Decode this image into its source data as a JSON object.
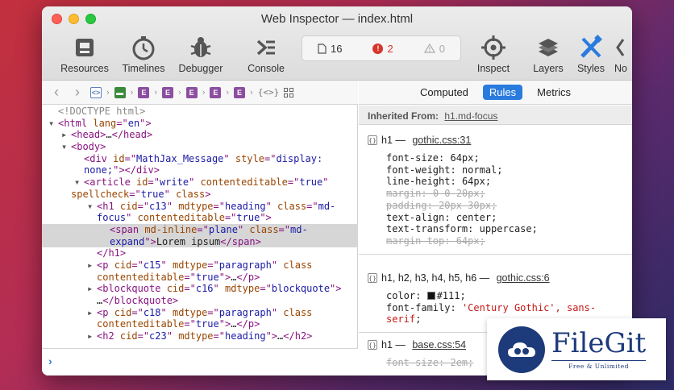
{
  "window": {
    "title": "Web Inspector — index.html"
  },
  "toolbar": {
    "tools": [
      {
        "label": "Resources",
        "icon": "resources-icon"
      },
      {
        "label": "Timelines",
        "icon": "timelines-icon"
      },
      {
        "label": "Debugger",
        "icon": "debugger-icon"
      },
      {
        "label": "Console",
        "icon": "console-icon"
      },
      {
        "label": "Inspect",
        "icon": "inspect-icon"
      },
      {
        "label": "Layers",
        "icon": "layers-icon"
      },
      {
        "label": "Styles",
        "icon": "styles-icon"
      },
      {
        "label": "No",
        "icon": "chevron-left-icon"
      }
    ],
    "status": {
      "resources_count": "16",
      "errors_count": "2",
      "warnings_count": "0"
    }
  },
  "breadcrumb": {
    "items": [
      "doc",
      "html",
      "E",
      "E",
      "E",
      "E",
      "E"
    ]
  },
  "dom_tree": {
    "doctype": "<!DOCTYPE html>",
    "lines": [
      {
        "indent": 0,
        "arrow": "▾",
        "parts": [
          [
            "tag",
            "<html "
          ],
          [
            "attr",
            "lang"
          ],
          [
            "tag",
            "=\""
          ],
          [
            "val",
            "en"
          ],
          [
            "tag",
            "\">"
          ]
        ]
      },
      {
        "indent": 1,
        "arrow": "▸",
        "parts": [
          [
            "tag",
            "<head>"
          ],
          [
            "txt",
            "…"
          ],
          [
            "tag",
            "</head>"
          ]
        ]
      },
      {
        "indent": 1,
        "arrow": "▾",
        "parts": [
          [
            "tag",
            "<body>"
          ]
        ]
      },
      {
        "indent": 2,
        "arrow": "",
        "parts": [
          [
            "tag",
            "<div "
          ],
          [
            "attr",
            "id"
          ],
          [
            "tag",
            "=\""
          ],
          [
            "val",
            "MathJax_Message"
          ],
          [
            "tag",
            "\" "
          ],
          [
            "attr",
            "style"
          ],
          [
            "tag",
            "=\""
          ],
          [
            "val",
            "display:"
          ]
        ]
      },
      {
        "indent": 2,
        "arrow": "",
        "parts": [
          [
            "val",
            "none;"
          ],
          [
            "tag",
            "\"></div>"
          ]
        ]
      },
      {
        "indent": 2,
        "arrow": "▾",
        "parts": [
          [
            "tag",
            "<article "
          ],
          [
            "attr",
            "id"
          ],
          [
            "tag",
            "=\""
          ],
          [
            "val",
            "write"
          ],
          [
            "tag",
            "\" "
          ],
          [
            "attr",
            "contenteditable"
          ],
          [
            "tag",
            "=\""
          ],
          [
            "val",
            "true"
          ],
          [
            "tag",
            "\""
          ]
        ]
      },
      {
        "indent": 1,
        "arrow": "",
        "parts": [
          [
            "attr",
            "spellcheck"
          ],
          [
            "tag",
            "=\""
          ],
          [
            "val",
            "true"
          ],
          [
            "tag",
            "\" "
          ],
          [
            "attr",
            "class"
          ],
          [
            "tag",
            ">"
          ]
        ]
      },
      {
        "indent": 3,
        "arrow": "▾",
        "parts": [
          [
            "tag",
            "<h1 "
          ],
          [
            "attr",
            "cid"
          ],
          [
            "tag",
            "=\""
          ],
          [
            "val",
            "c13"
          ],
          [
            "tag",
            "\" "
          ],
          [
            "attr",
            "mdtype"
          ],
          [
            "tag",
            "=\""
          ],
          [
            "val",
            "heading"
          ],
          [
            "tag",
            "\" "
          ],
          [
            "attr",
            "class"
          ],
          [
            "tag",
            "=\""
          ],
          [
            "val",
            "md-"
          ]
        ]
      },
      {
        "indent": 3,
        "arrow": "",
        "parts": [
          [
            "val",
            "focus"
          ],
          [
            "tag",
            "\" "
          ],
          [
            "attr",
            "contenteditable"
          ],
          [
            "tag",
            "=\""
          ],
          [
            "val",
            "true"
          ],
          [
            "tag",
            "\">"
          ]
        ]
      },
      {
        "indent": 4,
        "arrow": "",
        "sel": true,
        "parts": [
          [
            "tag",
            "<span "
          ],
          [
            "attr",
            "md-inline"
          ],
          [
            "tag",
            "=\""
          ],
          [
            "val",
            "plane"
          ],
          [
            "tag",
            "\" "
          ],
          [
            "attr",
            "class"
          ],
          [
            "tag",
            "=\""
          ],
          [
            "val",
            "md-"
          ]
        ]
      },
      {
        "indent": 4,
        "arrow": "",
        "sel": true,
        "parts": [
          [
            "val",
            "expand"
          ],
          [
            "tag",
            "\">"
          ],
          [
            "txt",
            "Lorem ipsum"
          ],
          [
            "tag",
            "</span>"
          ]
        ]
      },
      {
        "indent": 3,
        "arrow": "",
        "parts": [
          [
            "tag",
            "</h1>"
          ]
        ]
      },
      {
        "indent": 3,
        "arrow": "▸",
        "parts": [
          [
            "tag",
            "<p "
          ],
          [
            "attr",
            "cid"
          ],
          [
            "tag",
            "=\""
          ],
          [
            "val",
            "c15"
          ],
          [
            "tag",
            "\" "
          ],
          [
            "attr",
            "mdtype"
          ],
          [
            "tag",
            "=\""
          ],
          [
            "val",
            "paragraph"
          ],
          [
            "tag",
            "\" "
          ],
          [
            "attr",
            "class"
          ]
        ]
      },
      {
        "indent": 3,
        "arrow": "",
        "parts": [
          [
            "attr",
            "contenteditable"
          ],
          [
            "tag",
            "=\""
          ],
          [
            "val",
            "true"
          ],
          [
            "tag",
            "\">"
          ],
          [
            "txt",
            "…"
          ],
          [
            "tag",
            "</p>"
          ]
        ]
      },
      {
        "indent": 3,
        "arrow": "▸",
        "parts": [
          [
            "tag",
            "<blockquote "
          ],
          [
            "attr",
            "cid"
          ],
          [
            "tag",
            "=\""
          ],
          [
            "val",
            "c16"
          ],
          [
            "tag",
            "\" "
          ],
          [
            "attr",
            "mdtype"
          ],
          [
            "tag",
            "=\""
          ],
          [
            "val",
            "blockquote"
          ],
          [
            "tag",
            "\">"
          ]
        ]
      },
      {
        "indent": 3,
        "arrow": "",
        "parts": [
          [
            "txt",
            "…"
          ],
          [
            "tag",
            "</blockquote>"
          ]
        ]
      },
      {
        "indent": 3,
        "arrow": "▸",
        "parts": [
          [
            "tag",
            "<p "
          ],
          [
            "attr",
            "cid"
          ],
          [
            "tag",
            "=\""
          ],
          [
            "val",
            "c18"
          ],
          [
            "tag",
            "\" "
          ],
          [
            "attr",
            "mdtype"
          ],
          [
            "tag",
            "=\""
          ],
          [
            "val",
            "paragraph"
          ],
          [
            "tag",
            "\" "
          ],
          [
            "attr",
            "class"
          ]
        ]
      },
      {
        "indent": 3,
        "arrow": "",
        "parts": [
          [
            "attr",
            "contenteditable"
          ],
          [
            "tag",
            "=\""
          ],
          [
            "val",
            "true"
          ],
          [
            "tag",
            "\">"
          ],
          [
            "txt",
            "…"
          ],
          [
            "tag",
            "</p>"
          ]
        ]
      },
      {
        "indent": 3,
        "arrow": "▸",
        "parts": [
          [
            "tag",
            "<h2 "
          ],
          [
            "attr",
            "cid"
          ],
          [
            "tag",
            "=\""
          ],
          [
            "val",
            "c23"
          ],
          [
            "tag",
            "\" "
          ],
          [
            "attr",
            "mdtype"
          ],
          [
            "tag",
            "=\""
          ],
          [
            "val",
            "heading"
          ],
          [
            "tag",
            "\">"
          ],
          [
            "txt",
            "…"
          ],
          [
            "tag",
            "</h2>"
          ]
        ]
      }
    ]
  },
  "console": {
    "prompt": "›"
  },
  "sidebar_tabs": [
    {
      "label": "Computed",
      "active": false
    },
    {
      "label": "Rules",
      "active": true
    },
    {
      "label": "Metrics",
      "active": false
    }
  ],
  "inherited": {
    "label": "Inherited From:",
    "source": "h1.md-focus"
  },
  "rules": [
    {
      "selector": "h1 — ",
      "source": "gothic.css:31",
      "decls": [
        {
          "name": "font-size",
          "value": "64px",
          "over": false
        },
        {
          "name": "font-weight",
          "value": "normal",
          "over": false
        },
        {
          "name": "line-height",
          "value": "64px",
          "over": false
        },
        {
          "name": "margin",
          "value": "0 0 20px",
          "over": true
        },
        {
          "name": "padding",
          "value": "20px 30px",
          "over": true
        },
        {
          "name": "text-align",
          "value": "center",
          "over": false
        },
        {
          "name": "text-transform",
          "value": "uppercase",
          "over": false
        },
        {
          "name": "margin-top",
          "value": "64px",
          "over": true
        }
      ]
    },
    {
      "selector": "h1, h2, h3, h4, h5, h6 — ",
      "source": "gothic.css:6",
      "decls": [
        {
          "name": "color",
          "value": "#111",
          "over": false,
          "swatch": "#111111"
        },
        {
          "name": "font-family",
          "value": "'Century Gothic', sans-",
          "over": false,
          "string": true
        },
        {
          "name": "",
          "value": "serif",
          "over": false,
          "string": true,
          "cont": true
        }
      ]
    },
    {
      "selector": "h1 — ",
      "source": "base.css:54",
      "decls": [
        {
          "name": "font-size",
          "value": "2em",
          "over": true
        }
      ]
    }
  ],
  "watermark": {
    "name": "FileGit",
    "tagline": "Free & Unlimited"
  }
}
